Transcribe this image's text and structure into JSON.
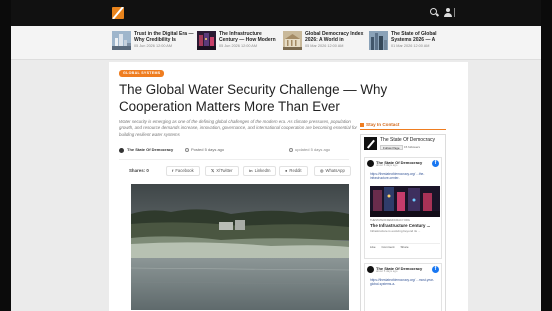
{
  "topbar": {
    "logo_icon": "pencil-logo-icon",
    "icons": [
      "search-icon",
      "user-icon"
    ],
    "accent": "#e8831c"
  },
  "trending": [
    {
      "title": "Trust in the Digital Era — Why Credibility Is",
      "date": "05 Jun 2026 12:00 AM",
      "thumb": "city-skyline"
    },
    {
      "title": "The Infrastructure Century — How Modern",
      "date": "05 Jun 2026 12:00 AM",
      "thumb": "city-night"
    },
    {
      "title": "Global Democracy Index 2026: A World in",
      "date": "05 Mar 2026 12:00 AM",
      "thumb": "parliament-building"
    },
    {
      "title": "The State of Global Systems 2026 — A",
      "date": "01 Mar 2026 12:00 AM",
      "thumb": "city-towers"
    }
  ],
  "article": {
    "category": "GLOBAL SYSTEMS",
    "title": "The Global Water Security Challenge — Why Cooperation Matters More Than Ever",
    "excerpt": "Water security is emerging as one of the defining global challenges of the modern era. As climate pressures, population growth, and resource demands increase, innovation, governance, and international cooperation are becoming essential for building resilient water systems",
    "author": "The State Of Democracy",
    "posted": "Posted 5 days ago",
    "updated": "updated 5 days ago",
    "shares_label": "Shares: 0",
    "share_buttons": [
      "Facebook",
      "X/Twitter",
      "LinkedIn",
      "Reddit",
      "WhatsApp"
    ]
  },
  "sidebar": {
    "heading": "Stay In Contact",
    "fb_page": {
      "name": "The State Of Democracy",
      "follow_label": "Follow Page",
      "followers": "15 followers"
    },
    "posts": [
      {
        "author": "The State Of Democracy",
        "time": "about 5 days ago",
        "link": "https://thestateofdemocracy.org/ ...the-infrastructure-center-",
        "domain": "THESTATEOFDEMOCRACY.ORG",
        "title": "The Infrastructure Century ...",
        "desc": "Infrastructure is evolving beyond its ...",
        "actions": [
          "Like",
          "Comment",
          "Share"
        ]
      },
      {
        "author": "The State Of Democracy",
        "time": "about 5 days ago",
        "link": "https://thestateofdemocracy.org/ ...most-year-global-systems-a-"
      }
    ]
  }
}
